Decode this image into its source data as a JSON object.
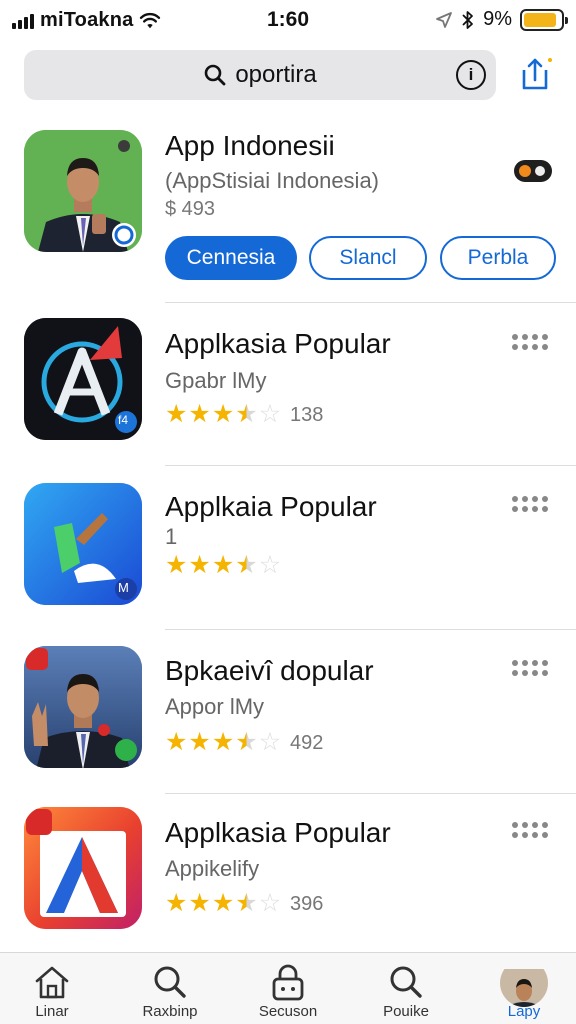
{
  "status_bar": {
    "carrier": "miToakna",
    "time": "1:60",
    "battery": "9%",
    "battery_level": 0.9
  },
  "search": {
    "query": "oportira"
  },
  "featured": {
    "title": "App Indonesii",
    "subtitle": "(AppStisiai Indonesia)",
    "price": "$ 493",
    "buttons": [
      "Cennesia",
      "Slancl",
      "Perbla"
    ]
  },
  "apps": [
    {
      "title": "Applkasia Popular",
      "subtitle": "Gpabr lMy",
      "rating": 3.5,
      "count": "138",
      "icon_label": "f4"
    },
    {
      "title": "Applkaia Popular",
      "subtitle": "1",
      "rating": 3.5,
      "count": "",
      "icon_label": "M"
    },
    {
      "title": "Bpkaeivî dopular",
      "subtitle": "Appor lMy",
      "rating": 3.5,
      "count": "492",
      "icon_label": ""
    },
    {
      "title": "Applkasia Popular",
      "subtitle": "Appikelify",
      "rating": 3.5,
      "count": "396",
      "icon_label": ""
    }
  ],
  "tabs": [
    {
      "label": "Linar",
      "icon": "home-icon"
    },
    {
      "label": "Raxbinp",
      "icon": "search-icon"
    },
    {
      "label": "Secuson",
      "icon": "lock-icon"
    },
    {
      "label": "Pouike",
      "icon": "search-icon"
    },
    {
      "label": "Lapy",
      "icon": "avatar"
    }
  ],
  "colors": {
    "accent": "#1469d6",
    "star": "#f4b400",
    "battery": "#f3b41a"
  }
}
